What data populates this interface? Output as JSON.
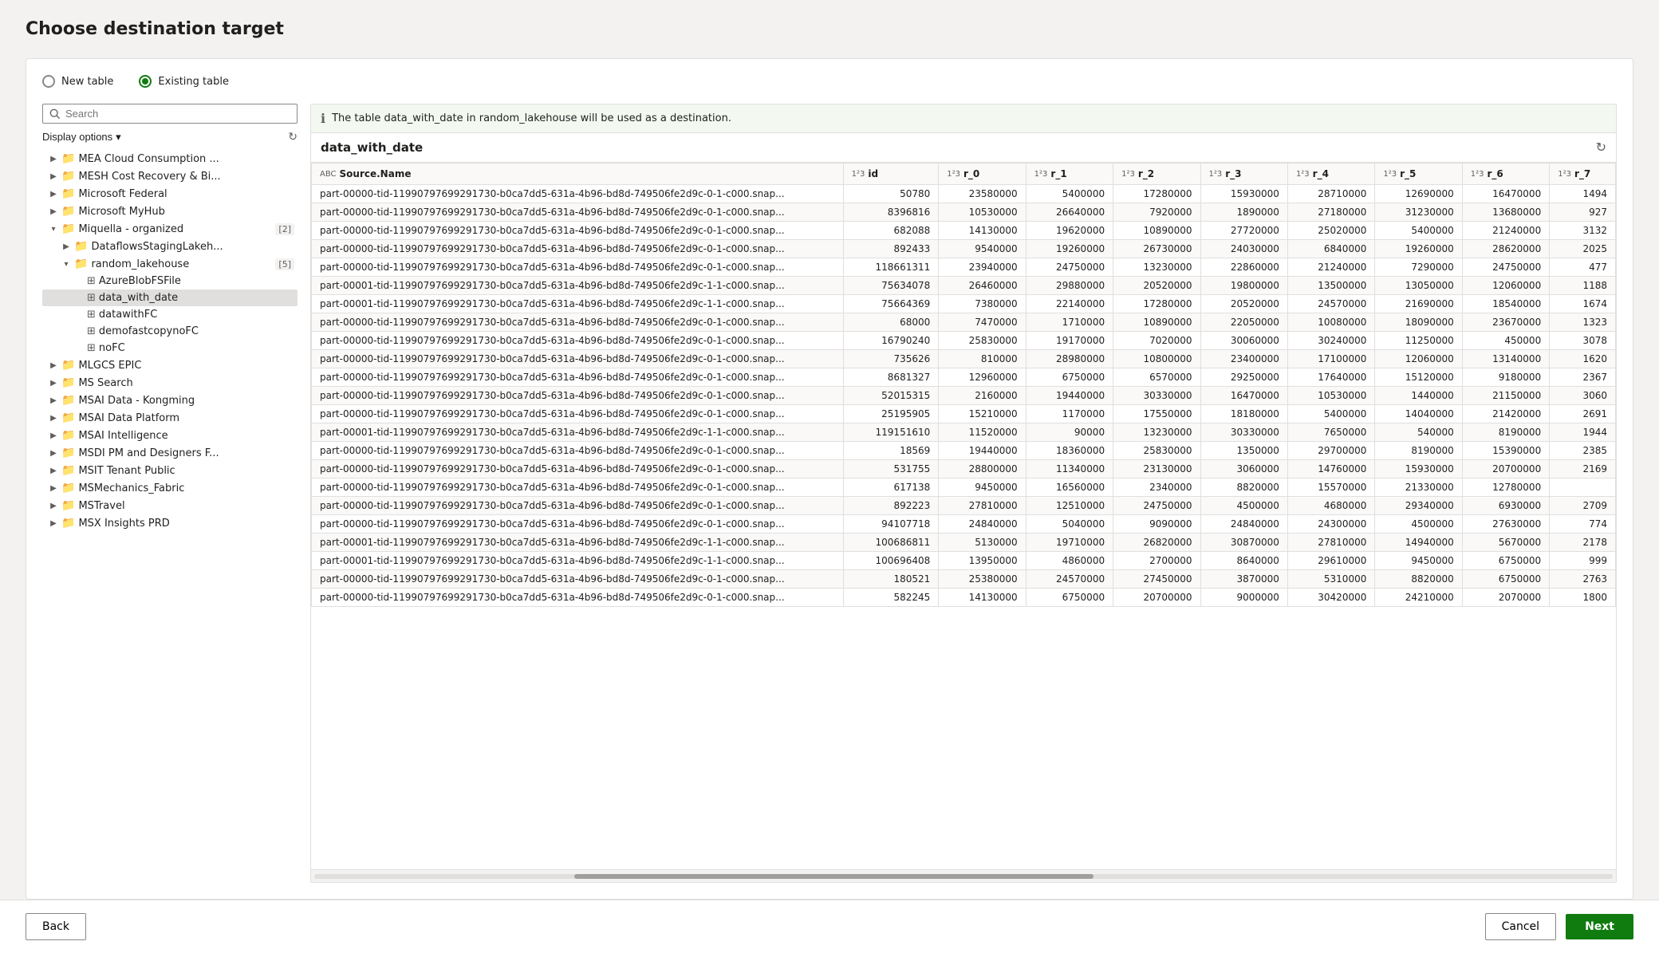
{
  "page": {
    "title": "Choose destination target"
  },
  "radio": {
    "new_table_label": "New table",
    "existing_table_label": "Existing table",
    "selected": "existing"
  },
  "search": {
    "placeholder": "Search"
  },
  "display_options": {
    "label": "Display options"
  },
  "tree": {
    "items": [
      {
        "id": "mea",
        "label": "MEA Cloud Consumption ...",
        "level": 1,
        "type": "folder",
        "expanded": false
      },
      {
        "id": "mesh",
        "label": "MESH Cost Recovery & Bi...",
        "level": 1,
        "type": "folder",
        "expanded": false
      },
      {
        "id": "msfederal",
        "label": "Microsoft Federal",
        "level": 1,
        "type": "folder",
        "expanded": false
      },
      {
        "id": "myhub",
        "label": "Microsoft MyHub",
        "level": 1,
        "type": "folder",
        "expanded": false
      },
      {
        "id": "miquella",
        "label": "Miquella - organized",
        "level": 1,
        "type": "folder",
        "expanded": true,
        "badge": "2"
      },
      {
        "id": "dataflows",
        "label": "DataflowsStagingLakeh...",
        "level": 2,
        "type": "folder",
        "expanded": false
      },
      {
        "id": "random_lakehouse",
        "label": "random_lakehouse",
        "level": 2,
        "type": "folder",
        "expanded": true,
        "badge": "5"
      },
      {
        "id": "azureblob",
        "label": "AzureBlobFSFile",
        "level": 3,
        "type": "table"
      },
      {
        "id": "data_with_date",
        "label": "data_with_date",
        "level": 3,
        "type": "table",
        "selected": true
      },
      {
        "id": "datawithfc",
        "label": "datawithFC",
        "level": 3,
        "type": "table"
      },
      {
        "id": "demofastcopy",
        "label": "demofastcopynoFC",
        "level": 3,
        "type": "table"
      },
      {
        "id": "nofc",
        "label": "noFC",
        "level": 3,
        "type": "table"
      },
      {
        "id": "mlgcs",
        "label": "MLGCS EPIC",
        "level": 1,
        "type": "folder",
        "expanded": false
      },
      {
        "id": "mssearch",
        "label": "MS Search",
        "level": 1,
        "type": "folder",
        "expanded": false
      },
      {
        "id": "msai_kongming",
        "label": "MSAI Data - Kongming",
        "level": 1,
        "type": "folder",
        "expanded": false
      },
      {
        "id": "msai_platform",
        "label": "MSAI Data Platform",
        "level": 1,
        "type": "folder",
        "expanded": false
      },
      {
        "id": "msai_intelligence",
        "label": "MSAI Intelligence",
        "level": 1,
        "type": "folder",
        "expanded": false
      },
      {
        "id": "msdi",
        "label": "MSDI PM and Designers F...",
        "level": 1,
        "type": "folder",
        "expanded": false
      },
      {
        "id": "msit",
        "label": "MSIT Tenant Public",
        "level": 1,
        "type": "folder",
        "expanded": false
      },
      {
        "id": "msmechanics",
        "label": "MSMechanics_Fabric",
        "level": 1,
        "type": "folder",
        "expanded": false
      },
      {
        "id": "mstravel",
        "label": "MSTravel",
        "level": 1,
        "type": "folder",
        "expanded": false
      },
      {
        "id": "msx",
        "label": "MSX Insights PRD",
        "level": 1,
        "type": "folder",
        "expanded": false
      }
    ]
  },
  "info_message": "The table data_with_date in random_lakehouse will be used as a destination.",
  "table_name": "data_with_date",
  "columns": [
    {
      "name": "Source.Name",
      "type": "ABC"
    },
    {
      "name": "id",
      "type": "1²3"
    },
    {
      "name": "r_0",
      "type": "1²3"
    },
    {
      "name": "r_1",
      "type": "1²3"
    },
    {
      "name": "r_2",
      "type": "1²3"
    },
    {
      "name": "r_3",
      "type": "1²3"
    },
    {
      "name": "r_4",
      "type": "1²3"
    },
    {
      "name": "r_5",
      "type": "1²3"
    },
    {
      "name": "r_6",
      "type": "1²3"
    },
    {
      "name": "r_7",
      "type": "1²3"
    }
  ],
  "rows": [
    {
      "source": "part-00000-tid-11990797699291730-b0ca7dd5-631a-4b96-bd8d-749506fe2d9c-0-1-c000.snap...",
      "id": "50780",
      "r0": "23580000",
      "r1": "5400000",
      "r2": "17280000",
      "r3": "15930000",
      "r4": "28710000",
      "r5": "12690000",
      "r6": "16470000",
      "r7": "1494"
    },
    {
      "source": "part-00000-tid-11990797699291730-b0ca7dd5-631a-4b96-bd8d-749506fe2d9c-0-1-c000.snap...",
      "id": "8396816",
      "r0": "10530000",
      "r1": "26640000",
      "r2": "7920000",
      "r3": "1890000",
      "r4": "27180000",
      "r5": "31230000",
      "r6": "13680000",
      "r7": "927"
    },
    {
      "source": "part-00000-tid-11990797699291730-b0ca7dd5-631a-4b96-bd8d-749506fe2d9c-0-1-c000.snap...",
      "id": "682088",
      "r0": "14130000",
      "r1": "19620000",
      "r2": "10890000",
      "r3": "27720000",
      "r4": "25020000",
      "r5": "5400000",
      "r6": "21240000",
      "r7": "3132"
    },
    {
      "source": "part-00000-tid-11990797699291730-b0ca7dd5-631a-4b96-bd8d-749506fe2d9c-0-1-c000.snap...",
      "id": "892433",
      "r0": "9540000",
      "r1": "19260000",
      "r2": "26730000",
      "r3": "24030000",
      "r4": "6840000",
      "r5": "19260000",
      "r6": "28620000",
      "r7": "2025"
    },
    {
      "source": "part-00000-tid-11990797699291730-b0ca7dd5-631a-4b96-bd8d-749506fe2d9c-0-1-c000.snap...",
      "id": "118661311",
      "r0": "23940000",
      "r1": "24750000",
      "r2": "13230000",
      "r3": "22860000",
      "r4": "21240000",
      "r5": "7290000",
      "r6": "24750000",
      "r7": "477"
    },
    {
      "source": "part-00001-tid-11990797699291730-b0ca7dd5-631a-4b96-bd8d-749506fe2d9c-1-1-c000.snap...",
      "id": "75634078",
      "r0": "26460000",
      "r1": "29880000",
      "r2": "20520000",
      "r3": "19800000",
      "r4": "13500000",
      "r5": "13050000",
      "r6": "12060000",
      "r7": "1188"
    },
    {
      "source": "part-00001-tid-11990797699291730-b0ca7dd5-631a-4b96-bd8d-749506fe2d9c-1-1-c000.snap...",
      "id": "75664369",
      "r0": "7380000",
      "r1": "22140000",
      "r2": "17280000",
      "r3": "20520000",
      "r4": "24570000",
      "r5": "21690000",
      "r6": "18540000",
      "r7": "1674"
    },
    {
      "source": "part-00000-tid-11990797699291730-b0ca7dd5-631a-4b96-bd8d-749506fe2d9c-0-1-c000.snap...",
      "id": "68000",
      "r0": "7470000",
      "r1": "1710000",
      "r2": "10890000",
      "r3": "22050000",
      "r4": "10080000",
      "r5": "18090000",
      "r6": "23670000",
      "r7": "1323"
    },
    {
      "source": "part-00000-tid-11990797699291730-b0ca7dd5-631a-4b96-bd8d-749506fe2d9c-0-1-c000.snap...",
      "id": "16790240",
      "r0": "25830000",
      "r1": "19170000",
      "r2": "7020000",
      "r3": "30060000",
      "r4": "30240000",
      "r5": "11250000",
      "r6": "450000",
      "r7": "3078"
    },
    {
      "source": "part-00000-tid-11990797699291730-b0ca7dd5-631a-4b96-bd8d-749506fe2d9c-0-1-c000.snap...",
      "id": "735626",
      "r0": "810000",
      "r1": "28980000",
      "r2": "10800000",
      "r3": "23400000",
      "r4": "17100000",
      "r5": "12060000",
      "r6": "13140000",
      "r7": "1620"
    },
    {
      "source": "part-00000-tid-11990797699291730-b0ca7dd5-631a-4b96-bd8d-749506fe2d9c-0-1-c000.snap...",
      "id": "8681327",
      "r0": "12960000",
      "r1": "6750000",
      "r2": "6570000",
      "r3": "29250000",
      "r4": "17640000",
      "r5": "15120000",
      "r6": "9180000",
      "r7": "2367"
    },
    {
      "source": "part-00000-tid-11990797699291730-b0ca7dd5-631a-4b96-bd8d-749506fe2d9c-0-1-c000.snap...",
      "id": "52015315",
      "r0": "2160000",
      "r1": "19440000",
      "r2": "30330000",
      "r3": "16470000",
      "r4": "10530000",
      "r5": "1440000",
      "r6": "21150000",
      "r7": "3060"
    },
    {
      "source": "part-00000-tid-11990797699291730-b0ca7dd5-631a-4b96-bd8d-749506fe2d9c-0-1-c000.snap...",
      "id": "25195905",
      "r0": "15210000",
      "r1": "1170000",
      "r2": "17550000",
      "r3": "18180000",
      "r4": "5400000",
      "r5": "14040000",
      "r6": "21420000",
      "r7": "2691"
    },
    {
      "source": "part-00001-tid-11990797699291730-b0ca7dd5-631a-4b96-bd8d-749506fe2d9c-1-1-c000.snap...",
      "id": "119151610",
      "r0": "11520000",
      "r1": "90000",
      "r2": "13230000",
      "r3": "30330000",
      "r4": "7650000",
      "r5": "540000",
      "r6": "8190000",
      "r7": "1944"
    },
    {
      "source": "part-00000-tid-11990797699291730-b0ca7dd5-631a-4b96-bd8d-749506fe2d9c-0-1-c000.snap...",
      "id": "18569",
      "r0": "19440000",
      "r1": "18360000",
      "r2": "25830000",
      "r3": "1350000",
      "r4": "29700000",
      "r5": "8190000",
      "r6": "15390000",
      "r7": "2385"
    },
    {
      "source": "part-00000-tid-11990797699291730-b0ca7dd5-631a-4b96-bd8d-749506fe2d9c-0-1-c000.snap...",
      "id": "531755",
      "r0": "28800000",
      "r1": "11340000",
      "r2": "23130000",
      "r3": "3060000",
      "r4": "14760000",
      "r5": "15930000",
      "r6": "20700000",
      "r7": "2169"
    },
    {
      "source": "part-00000-tid-11990797699291730-b0ca7dd5-631a-4b96-bd8d-749506fe2d9c-0-1-c000.snap...",
      "id": "617138",
      "r0": "9450000",
      "r1": "16560000",
      "r2": "2340000",
      "r3": "8820000",
      "r4": "15570000",
      "r5": "21330000",
      "r6": "12780000",
      "r7": ""
    },
    {
      "source": "part-00000-tid-11990797699291730-b0ca7dd5-631a-4b96-bd8d-749506fe2d9c-0-1-c000.snap...",
      "id": "892223",
      "r0": "27810000",
      "r1": "12510000",
      "r2": "24750000",
      "r3": "4500000",
      "r4": "4680000",
      "r5": "29340000",
      "r6": "6930000",
      "r7": "2709"
    },
    {
      "source": "part-00000-tid-11990797699291730-b0ca7dd5-631a-4b96-bd8d-749506fe2d9c-0-1-c000.snap...",
      "id": "94107718",
      "r0": "24840000",
      "r1": "5040000",
      "r2": "9090000",
      "r3": "24840000",
      "r4": "24300000",
      "r5": "4500000",
      "r6": "27630000",
      "r7": "774"
    },
    {
      "source": "part-00001-tid-11990797699291730-b0ca7dd5-631a-4b96-bd8d-749506fe2d9c-1-1-c000.snap...",
      "id": "100686811",
      "r0": "5130000",
      "r1": "19710000",
      "r2": "26820000",
      "r3": "30870000",
      "r4": "27810000",
      "r5": "14940000",
      "r6": "5670000",
      "r7": "2178"
    },
    {
      "source": "part-00001-tid-11990797699291730-b0ca7dd5-631a-4b96-bd8d-749506fe2d9c-1-1-c000.snap...",
      "id": "100696408",
      "r0": "13950000",
      "r1": "4860000",
      "r2": "2700000",
      "r3": "8640000",
      "r4": "29610000",
      "r5": "9450000",
      "r6": "6750000",
      "r7": "999"
    },
    {
      "source": "part-00000-tid-11990797699291730-b0ca7dd5-631a-4b96-bd8d-749506fe2d9c-0-1-c000.snap...",
      "id": "180521",
      "r0": "25380000",
      "r1": "24570000",
      "r2": "27450000",
      "r3": "3870000",
      "r4": "5310000",
      "r5": "8820000",
      "r6": "6750000",
      "r7": "2763"
    },
    {
      "source": "part-00000-tid-11990797699291730-b0ca7dd5-631a-4b96-bd8d-749506fe2d9c-0-1-c000.snap...",
      "id": "582245",
      "r0": "14130000",
      "r1": "6750000",
      "r2": "20700000",
      "r3": "9000000",
      "r4": "30420000",
      "r5": "24210000",
      "r6": "2070000",
      "r7": "1800"
    }
  ],
  "footer": {
    "back_label": "Back",
    "cancel_label": "Cancel",
    "next_label": "Next"
  }
}
